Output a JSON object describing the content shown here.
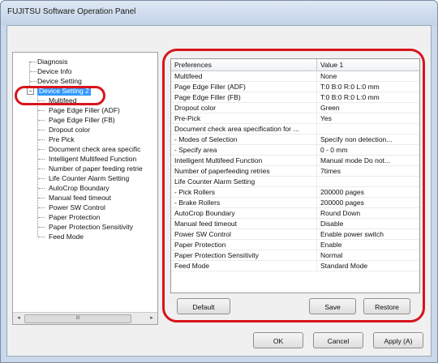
{
  "window": {
    "title": "FUJITSU Software Operation Panel"
  },
  "tree": {
    "items": [
      {
        "label": "Diagnosis",
        "indent": 0
      },
      {
        "label": "Device Info",
        "indent": 0
      },
      {
        "label": "Device Setting",
        "indent": 0
      },
      {
        "label": "Device Setting 2",
        "indent": 0,
        "selected": true,
        "expanded": true
      },
      {
        "label": "Multifeed",
        "indent": 1
      },
      {
        "label": "Page Edge Filler (ADF)",
        "indent": 1
      },
      {
        "label": "Page Edge Filler (FB)",
        "indent": 1
      },
      {
        "label": "Dropout color",
        "indent": 1
      },
      {
        "label": "Pre Pick",
        "indent": 1
      },
      {
        "label": "Document check area specific",
        "indent": 1
      },
      {
        "label": "Intelligent Multifeed Function",
        "indent": 1
      },
      {
        "label": "Number of paper feeding retrie",
        "indent": 1
      },
      {
        "label": "Life Counter Alarm Setting",
        "indent": 1
      },
      {
        "label": "AutoCrop Boundary",
        "indent": 1
      },
      {
        "label": "Manual feed timeout",
        "indent": 1
      },
      {
        "label": "Power SW Control",
        "indent": 1
      },
      {
        "label": "Paper Protection",
        "indent": 1
      },
      {
        "label": "Paper Protection Sensitivity",
        "indent": 1
      },
      {
        "label": "Feed Mode",
        "indent": 1
      }
    ],
    "expander_glyph": "−",
    "scroll_left": "◂",
    "scroll_right": "▸",
    "scroll_thumb": "III"
  },
  "grid": {
    "col_preferences": "Preferences",
    "col_value": "Value 1",
    "rows": [
      {
        "name": "Multifeed",
        "value": "None"
      },
      {
        "name": "Page Edge Filler (ADF)",
        "value": "T:0  B:0  R:0  L:0 mm"
      },
      {
        "name": "Page Edge Filler (FB)",
        "value": "T:0  B:0  R:0  L:0 mm"
      },
      {
        "name": "Dropout color",
        "value": "Green"
      },
      {
        "name": "Pre-Pick",
        "value": "Yes"
      },
      {
        "name": "Document check area specification for ...",
        "value": ""
      },
      {
        "name": "  - Modes of Selection",
        "value": "Specify non detection..."
      },
      {
        "name": "  - Specify area",
        "value": "0 - 0 mm"
      },
      {
        "name": "Intelligent Multifeed Function",
        "value": "Manual mode  Do not..."
      },
      {
        "name": "Number of paperfeeding retries",
        "value": "7times"
      },
      {
        "name": "Life Counter Alarm Setting",
        "value": ""
      },
      {
        "name": "  - Pick Rollers",
        "value": "200000 pages"
      },
      {
        "name": "  - Brake Rollers",
        "value": "200000 pages"
      },
      {
        "name": "AutoCrop Boundary",
        "value": "Round Down"
      },
      {
        "name": "Manual feed timeout",
        "value": "Disable"
      },
      {
        "name": "Power SW Control",
        "value": "Enable power switch"
      },
      {
        "name": "Paper Protection",
        "value": "Enable"
      },
      {
        "name": "Paper Protection Sensitivity",
        "value": "Normal"
      },
      {
        "name": "Feed Mode",
        "value": "Standard Mode"
      }
    ]
  },
  "buttons": {
    "default": "Default",
    "save": "Save",
    "restore": "Restore",
    "ok": "OK",
    "cancel": "Cancel",
    "apply": "Apply (A)"
  },
  "colors": {
    "highlight_circle": "#d8141b",
    "selection": "#3399ff"
  }
}
